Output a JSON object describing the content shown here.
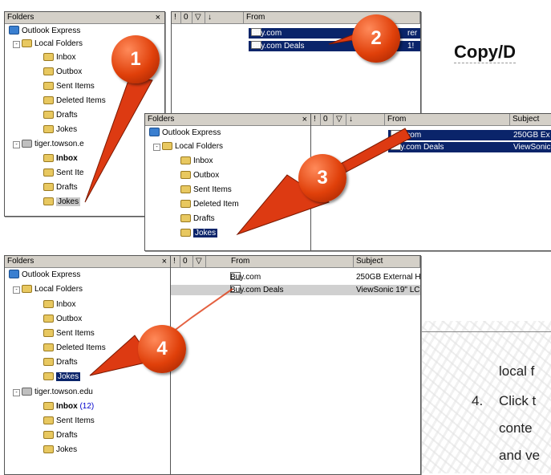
{
  "slide": {
    "title": "Copy/D",
    "text_line_1": "local f",
    "text_num_4": "4.",
    "text_line_2": "Click t",
    "text_line_3": "conte",
    "text_line_4": "and ve"
  },
  "colors": {
    "selection": "#0a246a",
    "badge": "#e0400a",
    "arrow": "#dd3a12",
    "pane_header": "#d4d0c8"
  },
  "folder_header": "Folders",
  "close_glyph": "×",
  "list_headers": {
    "col_priority": "!",
    "col_attach": "0",
    "col_flag": "▽",
    "col_sort": "↓",
    "from": "From",
    "subject": "Subject"
  },
  "messages": [
    {
      "from": "Buy.com",
      "subject": "250GB External H",
      "subject_snip3": "250GB Ex",
      "subject_snip1": "rer"
    },
    {
      "from": "Buy.com Deals",
      "subject": "ViewSonic 19\" LC",
      "subject_snip3": "ViewSonic",
      "subject_snip1": "1!"
    }
  ],
  "tree": {
    "root": "Outlook Express",
    "local": "Local Folders",
    "inbox": "Inbox",
    "outbox": "Outbox",
    "sent": "Sent Items",
    "deleted": "Deleted Items",
    "deleted_snip": "Deleted Item",
    "drafts": "Drafts",
    "jokes": "Jokes",
    "account": "tiger.towson.edu",
    "account_snip": "tiger.towson.e",
    "inbox_count": "(12)",
    "sent_snip": "Sent Ite"
  },
  "badges": {
    "b1": "1",
    "b2": "2",
    "b3": "3",
    "b4": "4"
  }
}
